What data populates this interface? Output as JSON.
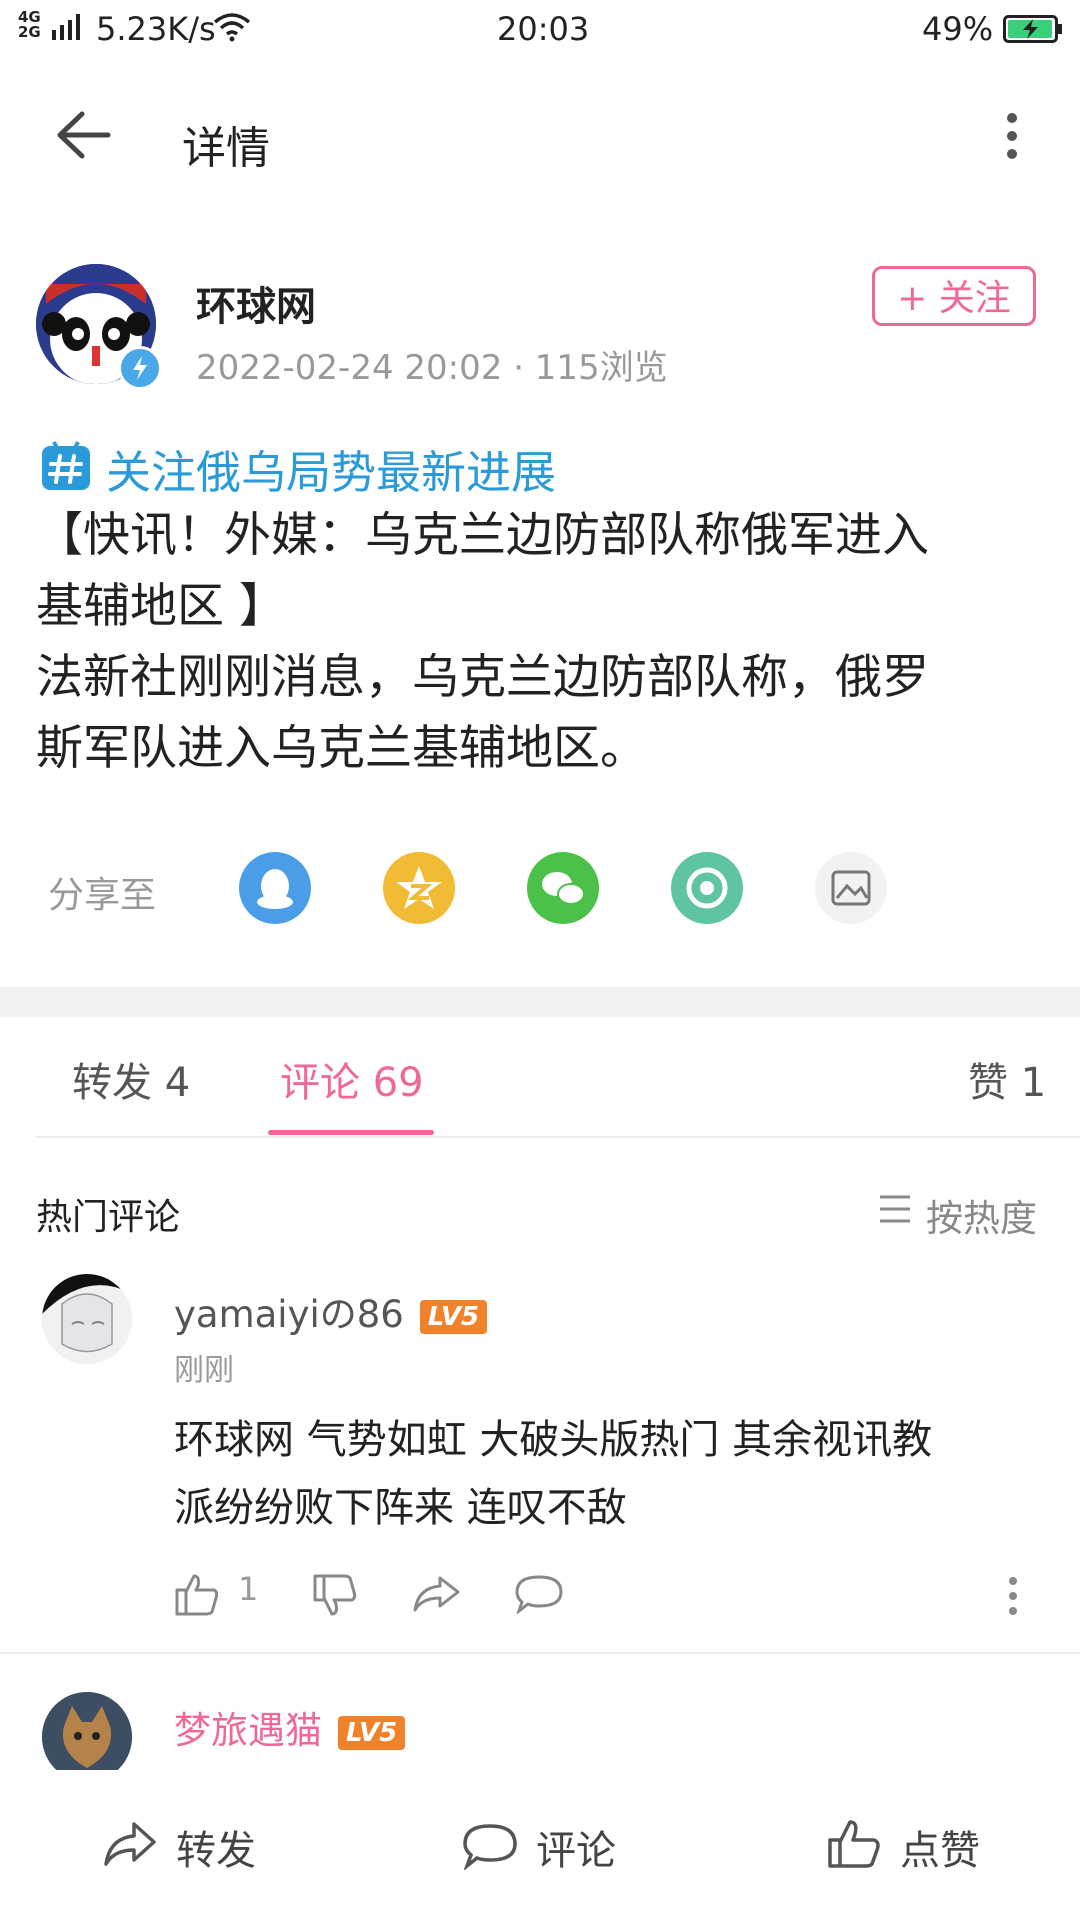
{
  "status_bar": {
    "network": "4G 2G",
    "speed": "5.23K/s",
    "time": "20:03",
    "battery": "49%"
  },
  "header": {
    "title": "详情",
    "back_icon": "back-arrow-icon",
    "more_icon": "more-vertical-icon"
  },
  "post": {
    "author": "环球网",
    "meta": "2022-02-24 20:02 · 115浏览",
    "follow_label": "+ 关注",
    "topic": "关注俄乌局势最新进展",
    "body_lines": [
      "【快讯！外媒：乌克兰边防部队称俄军进入",
      "基辅地区 】",
      "法新社刚刚消息，乌克兰边防部队称，俄罗",
      "斯军队进入乌克兰基辅地区。"
    ]
  },
  "share": {
    "label": "分享至",
    "targets": [
      {
        "name": "qq-icon",
        "color": "#4a9de6"
      },
      {
        "name": "qzone-icon",
        "color": "#f2bb35"
      },
      {
        "name": "wechat-icon",
        "color": "#4cc14a"
      },
      {
        "name": "moments-icon",
        "color": "#5ec4a3"
      },
      {
        "name": "save-image-icon",
        "color": "#f2f2f2"
      }
    ]
  },
  "tabs": {
    "repost": "转发 4",
    "comments": "评论 69",
    "likes": "赞 1"
  },
  "comments_section": {
    "title": "热门评论",
    "sort_label": "按热度",
    "items": [
      {
        "user": "yamaiyiの86",
        "level": "LV5",
        "time": "刚刚",
        "text_lines": [
          "环球网 气势如虹 大破头版热门 其余视讯教",
          "派纷纷败下阵来 连叹不敌"
        ],
        "likes": "1"
      },
      {
        "user": "梦旅遇猫",
        "level": "LV5"
      }
    ]
  },
  "bottom_bar": {
    "repost": "转发",
    "comment": "评论",
    "like": "点赞"
  },
  "colors": {
    "accent": "#f0679a",
    "topic": "#2b9ad8",
    "level_badge": "#f0822c"
  }
}
